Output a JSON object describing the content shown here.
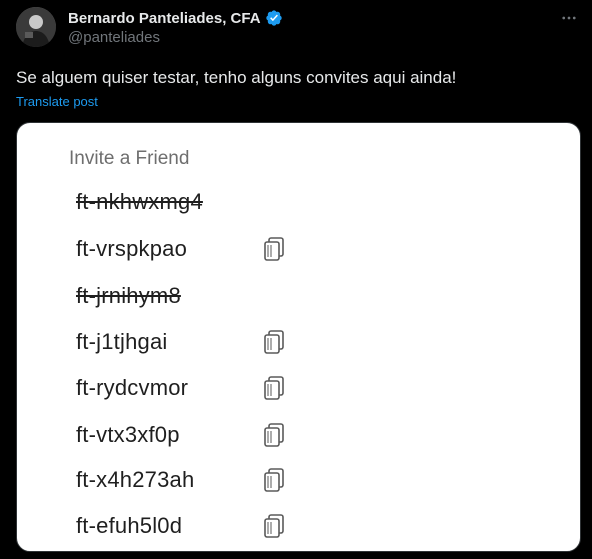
{
  "author": {
    "display_name": "Bernardo Panteliades, CFA",
    "handle": "@panteliades",
    "verified": true,
    "avatar": "avatar-photo"
  },
  "post": {
    "text": "Se alguem quiser testar, tenho alguns convites aqui ainda!",
    "translate_label": "Translate post"
  },
  "icons": {
    "more": "more-dots-icon",
    "verified": "verified-badge-icon",
    "copy": "copy-icon"
  },
  "colors": {
    "background": "#000000",
    "text": "#e7e9ea",
    "muted": "#71767b",
    "link": "#1d9bf0",
    "verified": "#1d9bf0"
  },
  "invite_card": {
    "title": "Invite a Friend",
    "codes": [
      {
        "code": "ft-nkhwxmg4",
        "used": true
      },
      {
        "code": "ft-vrspkpao",
        "used": false
      },
      {
        "code": "ft-jrnihym8",
        "used": true
      },
      {
        "code": "ft-j1tjhgai",
        "used": false
      },
      {
        "code": "ft-rydcvmor",
        "used": false
      },
      {
        "code": "ft-vtx3xf0p",
        "used": false
      },
      {
        "code": "ft-x4h273ah",
        "used": false
      },
      {
        "code": "ft-efuh5l0d",
        "used": false
      }
    ]
  }
}
